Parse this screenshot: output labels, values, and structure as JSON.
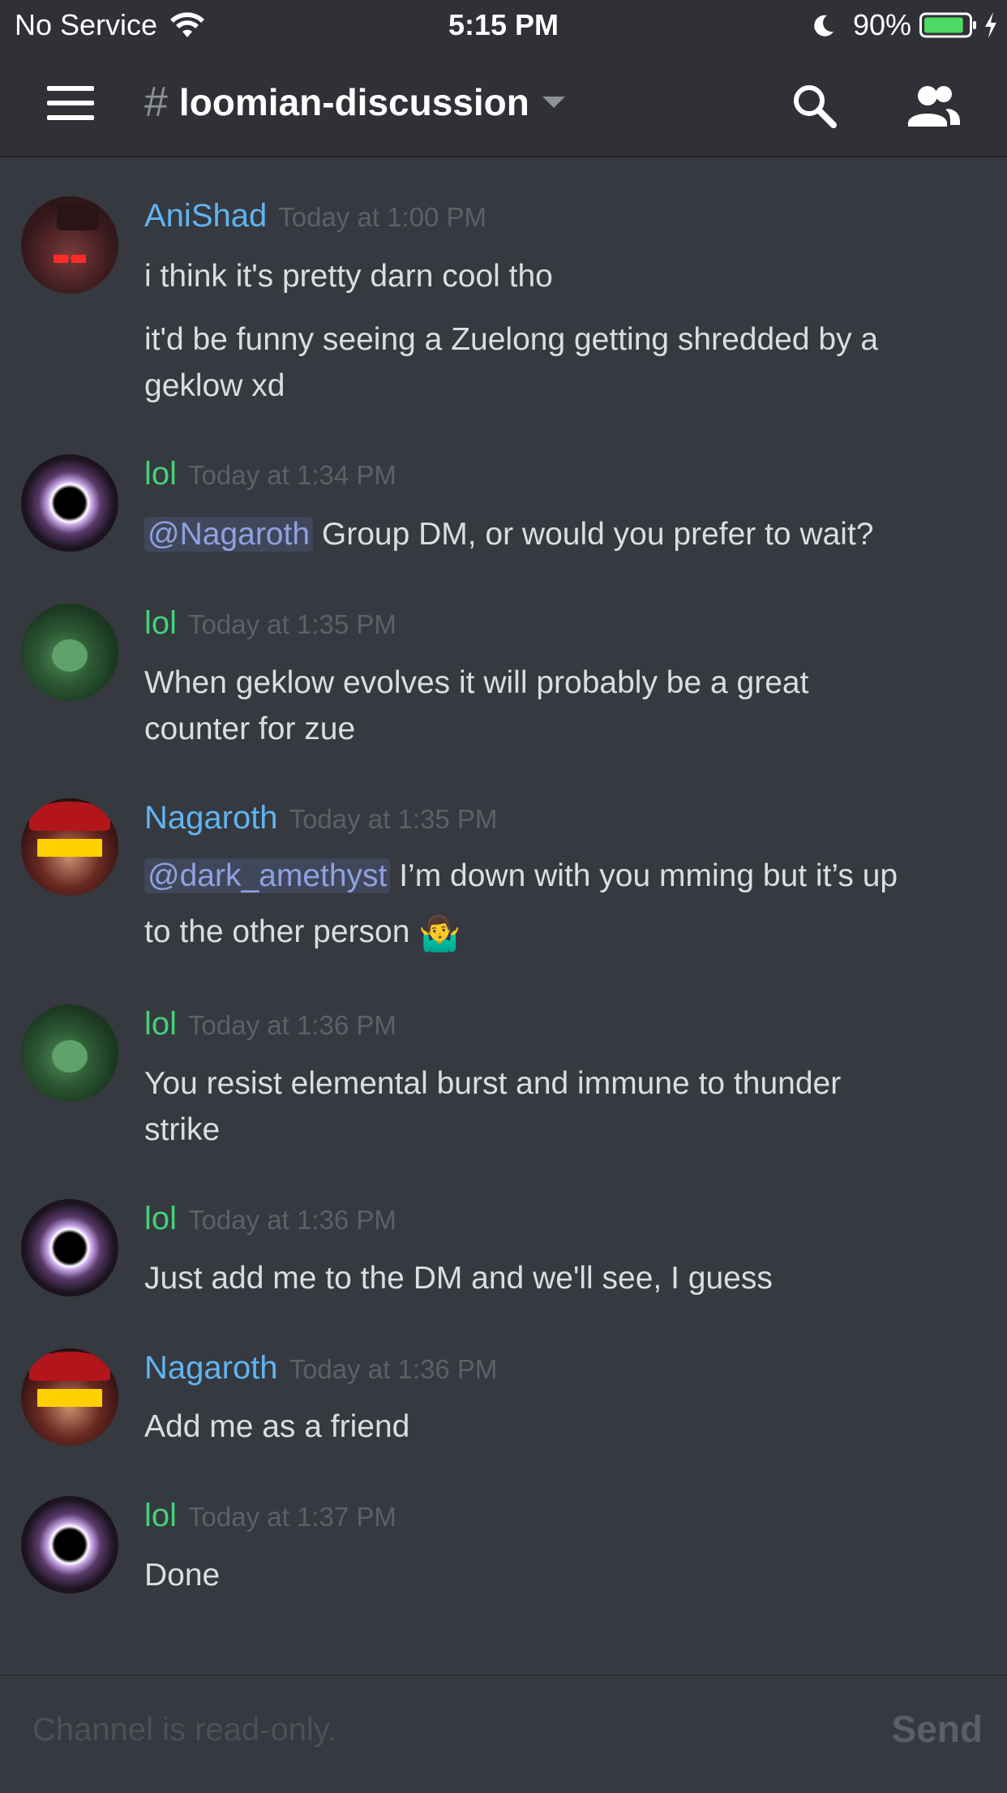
{
  "status_bar": {
    "carrier": "No Service",
    "time": "5:15 PM",
    "battery": "90%",
    "battery_level": 0.9
  },
  "header": {
    "hash": "#",
    "channel": "loomian-discussion"
  },
  "messages": [
    {
      "user": "AniShad",
      "time": "Today at 1:00 PM",
      "lines": [
        "i think it's pretty darn cool tho",
        "it'd be funny seeing a Zuelong getting shredded by a",
        "geklow xd"
      ]
    },
    {
      "user": "lol",
      "time": "Today at 1:34 PM",
      "mention": "@Nagaroth",
      "text": " Group DM, or would you prefer to wait?"
    },
    {
      "user": "lol",
      "time": "Today at 1:35 PM",
      "lines": [
        "When geklow evolves it will probably be a great",
        "counter for zue"
      ]
    },
    {
      "user": "Nagaroth",
      "time": "Today at 1:35 PM",
      "mention": "@dark_amethyst",
      "text": " I’m down with you mming but it’s up",
      "line2": "to the other person",
      "emoji": "🤷‍♂️"
    },
    {
      "user": "lol",
      "time": "Today at 1:36 PM",
      "lines": [
        "You resist elemental burst and immune to thunder",
        "strike"
      ]
    },
    {
      "user": "lol",
      "time": "Today at 1:36 PM",
      "lines": [
        "Just add me to the DM and we'll see, I guess"
      ]
    },
    {
      "user": "Nagaroth",
      "time": "Today at 1:36 PM",
      "lines": [
        "Add me as a friend"
      ]
    },
    {
      "user": "lol",
      "time": "Today at 1:37 PM",
      "lines": [
        "Done"
      ]
    }
  ],
  "composer": {
    "placeholder": "Channel is read-only.",
    "send_label": "Send"
  }
}
